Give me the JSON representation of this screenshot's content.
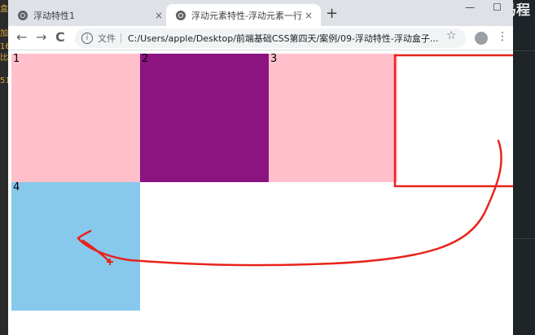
{
  "other_window": {
    "left_glyphs": [
      "盒",
      "加",
      "16",
      "比",
      "51"
    ],
    "brand_text": "黑马程"
  },
  "browser": {
    "tabs": [
      {
        "title": "浮动特性1",
        "active": false,
        "close": "×"
      },
      {
        "title": "浮动元素特性-浮动元素一行显示",
        "active": true,
        "close": "×"
      }
    ],
    "new_tab": "+",
    "window_controls": {
      "minimize": "—",
      "maximize": "☐"
    },
    "nav": {
      "back": "←",
      "forward": "→",
      "reload": "C"
    },
    "address": {
      "scheme": "文件",
      "url": "C:/Users/apple/Desktop/前端基础CSS第四天/案例/09-浮动特性-浮动盒子...",
      "info": "i"
    },
    "star": "☆",
    "menu": "⋮"
  },
  "page": {
    "boxes": [
      {
        "label": "1",
        "color": "#ffc0cb"
      },
      {
        "label": "2",
        "color": "#8b1480"
      },
      {
        "label": "3",
        "color": "#ffc0cb"
      },
      {
        "label": "4",
        "color": "#87c9ec"
      }
    ]
  },
  "annotation": {
    "color": "#e8231a"
  }
}
